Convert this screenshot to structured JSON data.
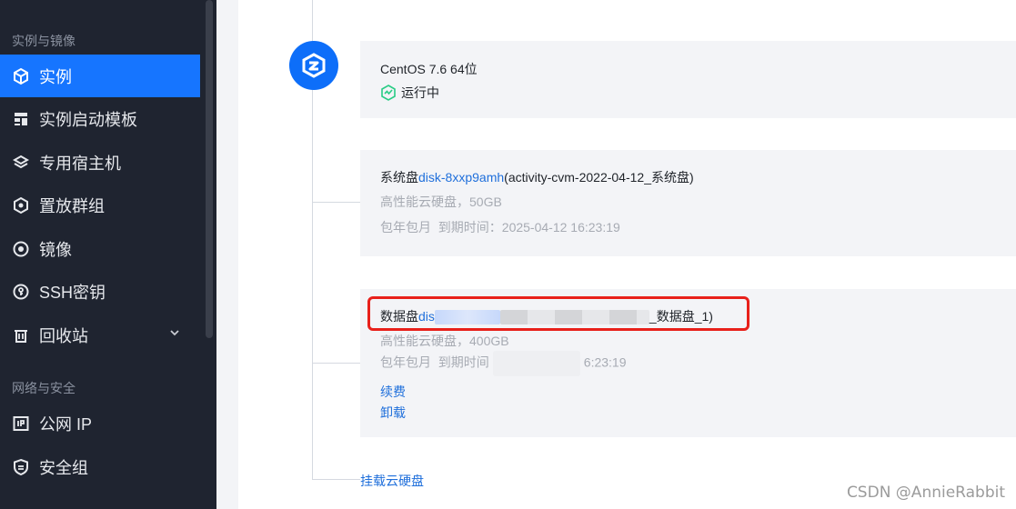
{
  "sidebar": {
    "group1": "实例与镜像",
    "items": [
      {
        "label": "实例",
        "icon": "cube-icon",
        "active": true
      },
      {
        "label": "实例启动模板",
        "icon": "template-icon"
      },
      {
        "label": "专用宿主机",
        "icon": "layers-icon"
      },
      {
        "label": "置放群组",
        "icon": "placement-icon"
      },
      {
        "label": "镜像",
        "icon": "disc-icon"
      },
      {
        "label": "SSH密钥",
        "icon": "key-icon"
      },
      {
        "label": "回收站",
        "icon": "trash-icon"
      }
    ],
    "group2": "网络与安全",
    "items2": [
      {
        "label": "公网 IP",
        "icon": "ip-icon"
      },
      {
        "label": "安全组",
        "icon": "shield-icon"
      }
    ]
  },
  "instance": {
    "os": "CentOS 7.6 64位",
    "status": "运行中"
  },
  "system_disk": {
    "prefix": "系统盘",
    "id": "disk-8xxp9amh",
    "name": "(activity-cvm-2022-04-12_系统盘)",
    "spec": "高性能云硬盘，50GB",
    "billing": "包年包月",
    "expiry_label": "到期时间：",
    "expiry": "2025-04-12 16:23:19"
  },
  "data_disk": {
    "prefix": "数据盘",
    "id_visible": "dis",
    "name_suffix": "_数据盘_1)",
    "spec": "高性能云硬盘，400GB",
    "billing": "包年包月",
    "expiry_label": "到期时间",
    "expiry_visible": "6:23:19",
    "renew": "续费",
    "unmount": "卸载"
  },
  "mount_link": "挂载云硬盘",
  "watermark": "CSDN @AnnieRabbit",
  "colors": {
    "sidebar_bg": "#1f2430",
    "active": "#1675ff",
    "link": "#1f6fdb",
    "highlight": "#e8201a",
    "status_green": "#29cc85"
  }
}
